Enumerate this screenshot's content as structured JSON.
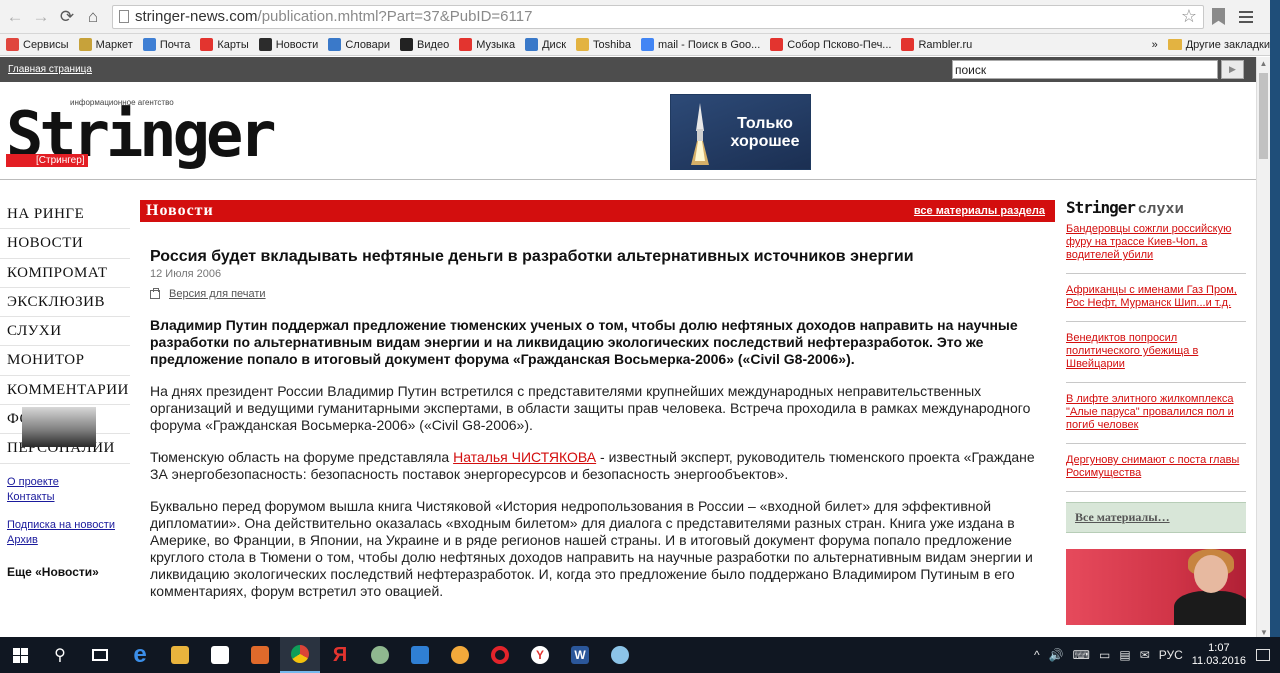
{
  "browser": {
    "url_domain": "stringer-news.com",
    "url_path": "/publication.mhtml?Part=37&PubID=6117",
    "bookmarks": [
      {
        "label": "Сервисы",
        "color": "#e0463e"
      },
      {
        "label": "Маркет",
        "color": "#c7a23a"
      },
      {
        "label": "Почта",
        "color": "#3f7fd4"
      },
      {
        "label": "Карты",
        "color": "#e3342f"
      },
      {
        "label": "Новости",
        "color": "#2c2c2c"
      },
      {
        "label": "Словари",
        "color": "#3a79c9"
      },
      {
        "label": "Видео",
        "color": "#222222"
      },
      {
        "label": "Музыка",
        "color": "#e3342f"
      },
      {
        "label": "Диск",
        "color": "#3a79c9"
      },
      {
        "label": "Toshiba",
        "color": "#e3b341"
      },
      {
        "label": "mail - Поиск в Goo...",
        "color": "#4285f4"
      },
      {
        "label": "Собор Псково-Печ...",
        "color": "#e3342f"
      },
      {
        "label": "Rambler.ru",
        "color": "#e3342f"
      }
    ],
    "bookmarks_overflow": "»",
    "other_bookmarks": "Другие закладки"
  },
  "site": {
    "home_link": "Главная страница",
    "search_value": "поиск",
    "logo_tagline": "информационное агентство",
    "logo_word": "Stringer",
    "logo_sub": "[Стрингер]",
    "promo_text": "Только хорошее"
  },
  "leftnav": {
    "items": [
      "НА РИНГЕ",
      "НОВОСТИ",
      "КОМПРОМАТ",
      "ЭКСКЛЮЗИВ",
      "СЛУХИ",
      "МОНИТОР",
      "КОММЕНТАРИИ",
      "ФОТО",
      "ПЕРСОНАЛИИ"
    ],
    "about": "О проекте",
    "contacts": "Контакты",
    "subscribe": "Подписка на новости",
    "archive": "Архив",
    "more_news": "Еще «Новости»"
  },
  "main": {
    "section_title": "Новости",
    "section_all": "все материалы раздела",
    "title": "Россия будет вкладывать нефтяные деньги в разработки альтернативных источников энергии",
    "date": "12 Июля 2006",
    "print_link": "Версия для печати",
    "lead": "Владимир Путин поддержал предложение тюменских ученых о том, чтобы долю нефтяных доходов направить на научные разработки по альтернативным видам энергии и на ликвидацию экологических последствий нефтеразработок. Это же предложение попало в итоговый документ форума «Гражданская Восьмерка-2006» («Civil G8-2006»).",
    "para1": "На днях президент России Владимир Путин встретился с представителями крупнейших международных неправительственных организаций и ведущими гуманитарными экспертами, в области защиты прав человека. Встреча проходила в рамках международного форума «Гражданская Восьмерка-2006» («Civil G8-2006»).",
    "para2_before": "Тюменскую область на форуме представляла ",
    "para2_person": "Наталья ЧИСТЯКОВА",
    "para2_after": " - известный эксперт, руководитель тюменского проекта «Граждане ЗА энергобезопасность: безопасность поставок энергоресурсов и безопасность энергообъектов».",
    "para3": "Буквально перед форумом вышла книга Чистяковой «История недропользования в России – «входной билет» для эффективной дипломатии». Она действительно оказалась «входным билетом» для диалога с представителями разных стран. Книга уже издана в Америке, во Франции, в Японии, на Украине и в ряде регионов нашей страны. И в итоговый документ форума попало предложение круглого стола в Тюмени о том, чтобы долю нефтяных доходов направить на научные разработки по альтернативным видам энергии и ликвидацию экологических последствий нефтеразработок. И, когда это предложение было поддержано Владимиром Путиным в его комментариях, форум встретил это овацией."
  },
  "right": {
    "brand": "Stringer",
    "rubric": "слухи",
    "items": [
      "Бандеровцы сожгли российскую фуру на трассе Киев-Чоп, а водителей убили",
      "Африканцы с именами Газ Пром, Рос Нефт, Мурманск Шип...и т.д.",
      "Венедиктов попросил политического убежища в Швейцарии",
      "В лифте элитного жилкомплекса \"Алые паруса\" провалился пол и погиб человек",
      "Дергунову снимают с поста главы Росимущества"
    ],
    "all_link": "Все материалы…"
  },
  "taskbar": {
    "lang": "РУС",
    "time": "1:07",
    "date": "11.03.2016"
  },
  "colors": {
    "accent_red": "#d30e0e",
    "dark_strip": "#4d4d4d"
  }
}
